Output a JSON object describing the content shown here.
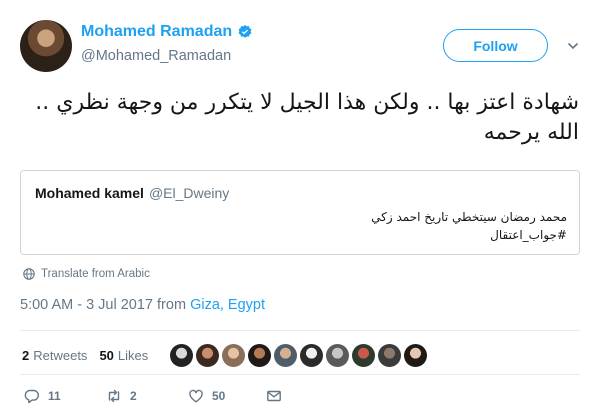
{
  "author": {
    "display_name": "Mohamed Ramadan",
    "handle": "@Mohamed_Ramadan"
  },
  "follow_button": {
    "label": "Follow"
  },
  "tweet": {
    "text_line1": "شهادة اعتز بها .. ولكن هذا الجيل لا يتكرر من وجهة نظري ..",
    "text_line2": "الله يرحمه"
  },
  "quoted_tweet": {
    "display_name": "Mohamed kamel",
    "handle": "@El_Dweiny",
    "text_line1": "محمد رمضان سيتخطي تاريخ احمد زكي",
    "text_line2": "#جواب_اعتقال"
  },
  "translate": {
    "label": "Translate from Arabic"
  },
  "timestamp": {
    "time": "5:00 AM - 3 Jul 2017",
    "from": "from",
    "location": "Giza, Egypt"
  },
  "stats": {
    "retweets_count": "2",
    "retweets_label": "Retweets",
    "likes_count": "50",
    "likes_label": "Likes"
  },
  "actions": {
    "reply_count": "11",
    "retweet_count": "2",
    "like_count": "50"
  },
  "colors": {
    "accent": "#1da1f2",
    "muted": "#657786",
    "text": "#14171a",
    "border": "#e6ecf0"
  },
  "icons": [
    "verified-badge-icon",
    "chevron-down-icon",
    "globe-icon",
    "reply-icon",
    "retweet-icon",
    "heart-icon",
    "envelope-icon"
  ]
}
